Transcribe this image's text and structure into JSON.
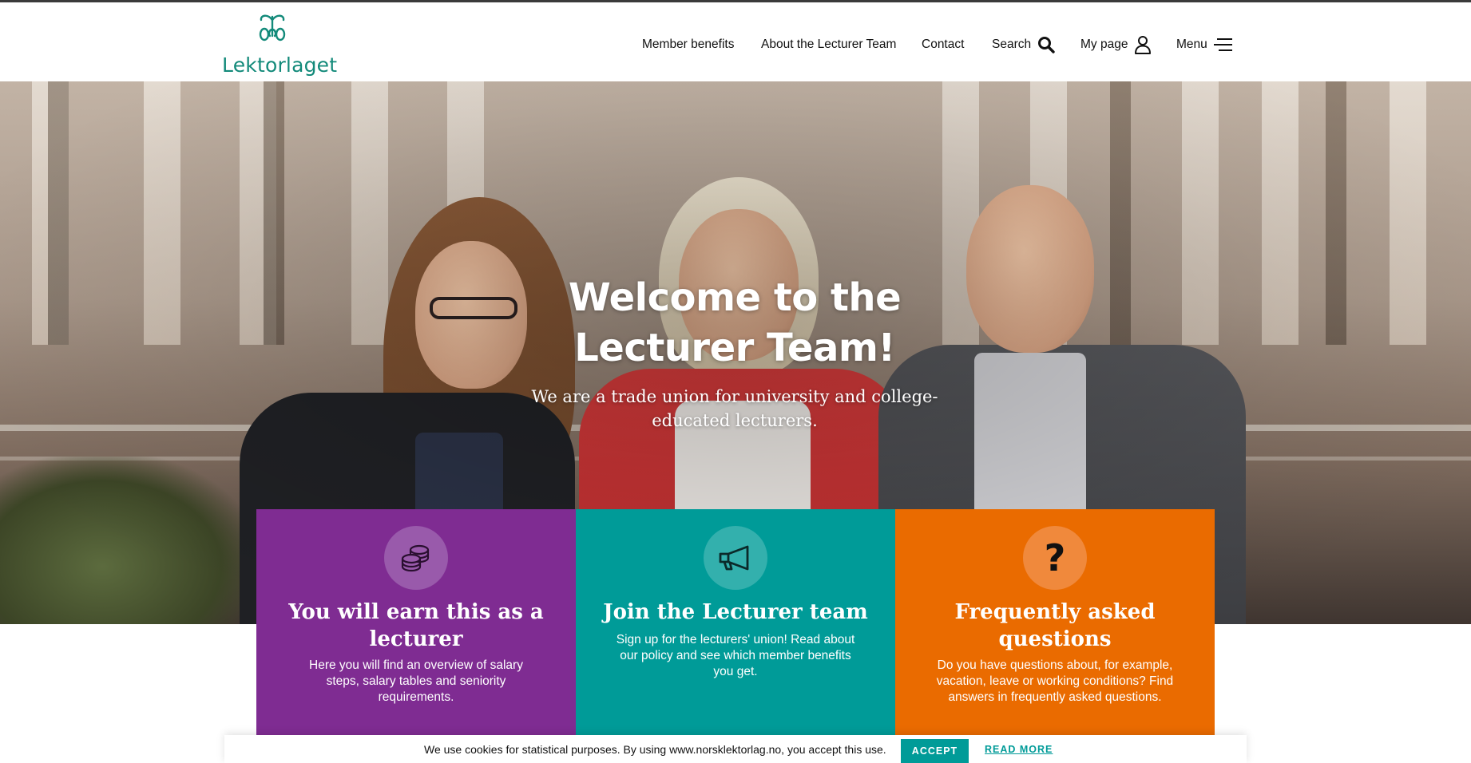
{
  "brand": {
    "name": "Lektorlaget",
    "color": "#138a7a"
  },
  "nav": {
    "member_benefits": "Member benefits",
    "about": "About the Lecturer Team",
    "contact": "Contact",
    "search": "Search",
    "my_page": "My page",
    "menu": "Menu",
    "icons": [
      "search-icon",
      "user-icon",
      "hamburger-menu-icon"
    ]
  },
  "hero": {
    "title": "Welcome to the Lecturer Team!",
    "subtitle": "We are a trade union for university and college-educated lecturers."
  },
  "cards": [
    {
      "icon": "coins-icon",
      "title": "You will earn this as a lecturer",
      "text": "Here you will find an overview of salary steps, salary tables and seniority requirements.",
      "color": "#7f2c92"
    },
    {
      "icon": "megaphone-icon",
      "title": "Join the Lecturer team",
      "text": "Sign up for the lecturers' union! Read about our policy and see which member benefits you get.",
      "color": "#009b98"
    },
    {
      "icon": "question-mark-icon",
      "title": "Frequently asked questions",
      "text": "Do you have questions about, for example, vacation, leave or working conditions? Find answers in frequently asked questions.",
      "color": "#ea6b00"
    }
  ],
  "cookie": {
    "text": "We use cookies for statistical purposes. By using www.norsklektorlag.no, you accept this use.",
    "accept": "ACCEPT",
    "read_more": "READ MORE"
  }
}
